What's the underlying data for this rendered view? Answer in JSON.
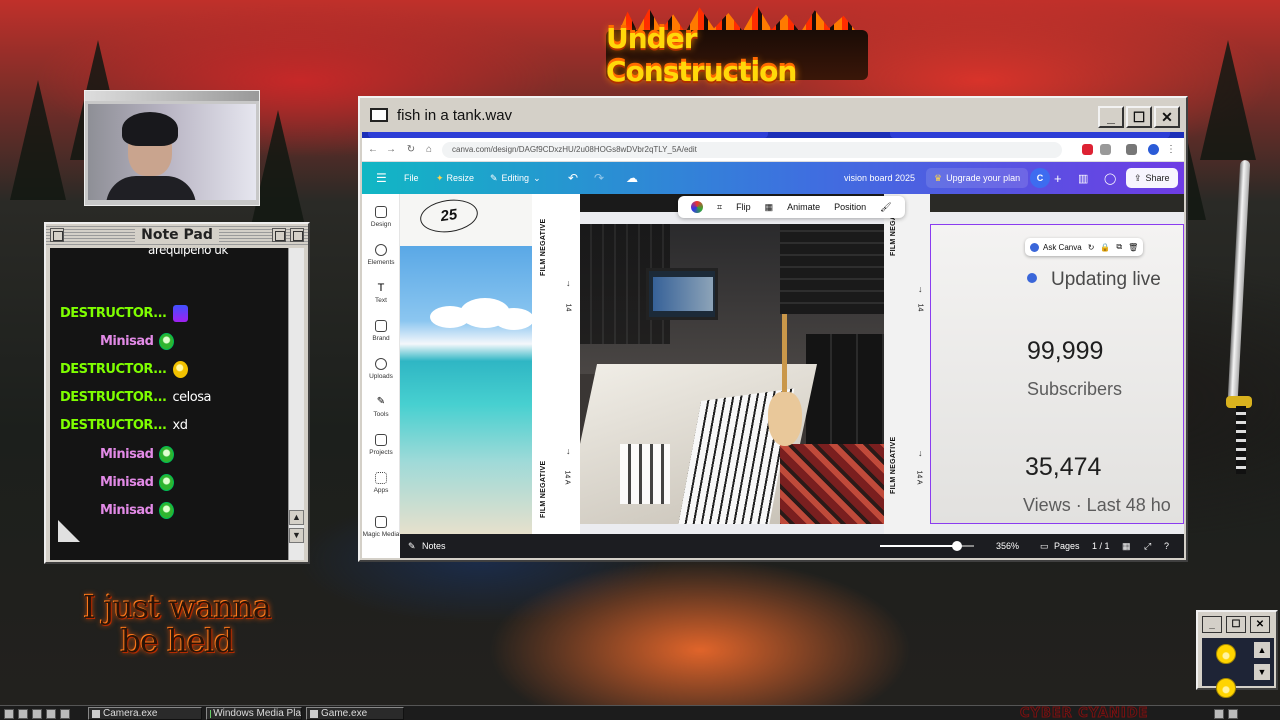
{
  "banner": {
    "text": "Under Construction"
  },
  "notepad": {
    "title": "Note Pad",
    "messages": [
      {
        "name": "",
        "text": "arequipeño uk",
        "name_color": "#ffffff",
        "emote": ""
      },
      {
        "name": "DESTRUCTOR...",
        "text": "",
        "name_color": "#7fff00",
        "emote": "blue"
      },
      {
        "name": "Minisad",
        "text": "",
        "name_color": "#e28ae6",
        "emote": "green"
      },
      {
        "name": "DESTRUCTOR...",
        "text": "",
        "name_color": "#7fff00",
        "emote": "yellow"
      },
      {
        "name": "DESTRUCTOR...",
        "text": "celosa",
        "name_color": "#7fff00",
        "emote": ""
      },
      {
        "name": "DESTRUCTOR...",
        "text": "xd",
        "name_color": "#7fff00",
        "emote": ""
      },
      {
        "name": "Minisad",
        "text": "",
        "name_color": "#e28ae6",
        "emote": "green"
      },
      {
        "name": "Minisad",
        "text": "",
        "name_color": "#e28ae6",
        "emote": "green"
      },
      {
        "name": "Minisad",
        "text": "",
        "name_color": "#e28ae6",
        "emote": "green"
      }
    ]
  },
  "overlay_text": {
    "line1": "I just wanna",
    "line2": "be held"
  },
  "window": {
    "title": "fish in a tank.wav",
    "minimize": "_",
    "maximize": "☐",
    "close": "✕"
  },
  "browser": {
    "url": "canva.com/design/DAGf9CDxzHU/2u08HOGs8wDVbr2qTLY_5A/edit"
  },
  "canva": {
    "menu": {
      "file": "File",
      "resize": "Resize",
      "editing": "Editing"
    },
    "design_name": "vision board 2025",
    "upgrade": "Upgrade your plan",
    "avatar_letter": "C",
    "share": "Share",
    "sidebar": [
      {
        "label": "Design",
        "icon": "layout-icon"
      },
      {
        "label": "Elements",
        "icon": "shapes-icon"
      },
      {
        "label": "Text",
        "icon": "text-icon"
      },
      {
        "label": "Brand",
        "icon": "crown-icon"
      },
      {
        "label": "Uploads",
        "icon": "upload-icon"
      },
      {
        "label": "Tools",
        "icon": "pen-icon"
      },
      {
        "label": "Projects",
        "icon": "folder-icon"
      },
      {
        "label": "Apps",
        "icon": "apps-icon"
      },
      {
        "label": "Magic Media",
        "icon": "magic-icon"
      }
    ],
    "element_toolbar": {
      "flip": "Flip",
      "animate": "Animate",
      "position": "Position"
    },
    "ask_canva": "Ask Canva",
    "film": {
      "label": "FILM NEGATIVE",
      "frame": "14",
      "frame_a": "14 A",
      "sticker_number": "25"
    },
    "stats": {
      "status": "Updating live",
      "subscribers": "99,999",
      "subscribers_label": "Subscribers",
      "views": "35,474",
      "views_label": "Views · Last 48 ho"
    },
    "footer": {
      "notes": "Notes",
      "zoom": "356%",
      "zoom_fraction": 0.82,
      "pages": "Pages",
      "page_count": "1 / 1"
    }
  },
  "taskbar": {
    "items": [
      "Camera.exe",
      "Windows Media Pla",
      "Game.exe"
    ],
    "brand": "CYBER CYANIDE"
  }
}
